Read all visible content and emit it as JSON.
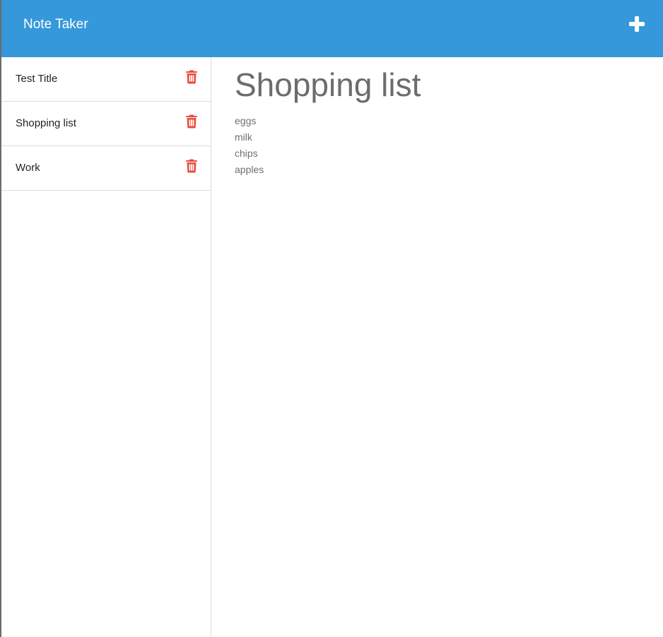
{
  "app": {
    "title": "Note Taker"
  },
  "notes": [
    {
      "title": "Test Title"
    },
    {
      "title": "Shopping list"
    },
    {
      "title": "Work"
    }
  ],
  "active_note": {
    "title": "Shopping list",
    "body": "eggs\nmilk\nchips\napples"
  },
  "icons": {
    "new_note": "plus-icon",
    "delete": "trash-icon"
  },
  "colors": {
    "header": "#3498db",
    "delete": "#e74c3c",
    "sidebar_border": "#dddddd",
    "text": "#222222",
    "heading": "#6c6c6c"
  }
}
